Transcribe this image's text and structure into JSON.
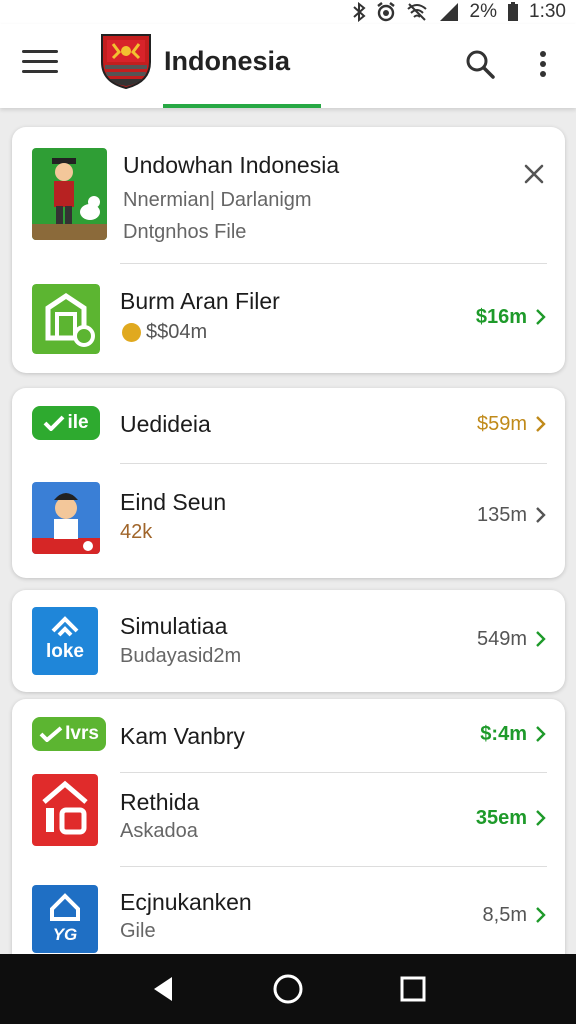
{
  "status_bar": {
    "battery": "2%",
    "time": "1:30"
  },
  "app_bar": {
    "title": "Indonesia"
  },
  "card1": {
    "featured": {
      "title": "Undowhan Indonesia",
      "line1": "Nnermian| Darlanigm",
      "line2": "Dntgnhos File"
    },
    "row": {
      "title": "Burm Aran Filer",
      "sub": "$$04m",
      "price": "$16m"
    }
  },
  "card2": {
    "row1": {
      "badge": "ile",
      "title": "Uedideia",
      "price": "$59m"
    },
    "row2": {
      "title": "Eind Seun",
      "sub": "42k",
      "price": "135m"
    }
  },
  "card3": {
    "row1": {
      "icon_text": "loke",
      "title": "Simulatiaa",
      "sub": "Budayasid2m",
      "price": "549m"
    }
  },
  "card4": {
    "row1": {
      "badge": "Ivrs",
      "title": "Kam Vanbry",
      "price": "$:4m"
    },
    "row2": {
      "title": "Rethida",
      "sub": "Askadoa",
      "price": "35em"
    },
    "row3": {
      "icon_text": "YG",
      "title": "Ecjnukanken",
      "sub": "Gile",
      "price": "8,5m"
    }
  },
  "colors": {
    "accent_green": "#27a844",
    "price_green": "#1e9a2a",
    "price_gold": "#c08a1a",
    "price_gray": "#555555",
    "sub_brown": "#a0652a"
  },
  "icons": [
    "menu-icon",
    "crest-logo",
    "search-icon",
    "more-vert-icon",
    "close-icon",
    "chevron-right-icon",
    "back-icon",
    "home-icon",
    "recents-icon"
  ]
}
